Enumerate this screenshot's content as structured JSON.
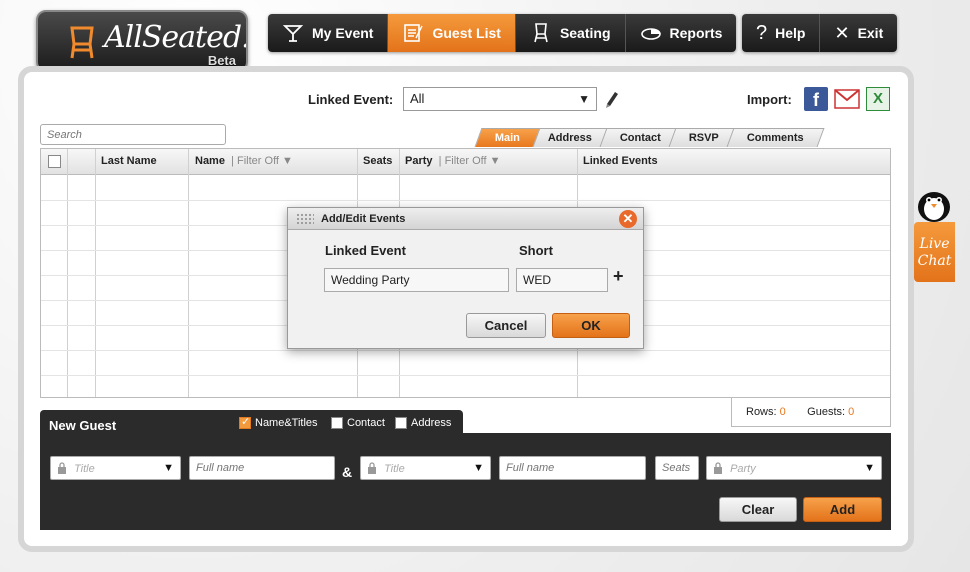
{
  "app": {
    "logo_text": "AllSeated.",
    "logo_badge": "Beta"
  },
  "nav": {
    "items": [
      {
        "label": "My Event",
        "icon": "cocktail-icon"
      },
      {
        "label": "Guest List",
        "icon": "list-icon",
        "active": true
      },
      {
        "label": "Seating",
        "icon": "chair-icon"
      },
      {
        "label": "Reports",
        "icon": "pie-chart-icon"
      }
    ],
    "help_label": "Help",
    "exit_label": "Exit"
  },
  "toolbar": {
    "linked_event_label": "Linked Event:",
    "linked_event_value": "All",
    "import_label": "Import:"
  },
  "search": {
    "placeholder": "Search"
  },
  "tabs": [
    "Main",
    "Address",
    "Contact",
    "RSVP",
    "Comments"
  ],
  "grid": {
    "headers": {
      "last_name": "Last Name",
      "name": "Name",
      "name_filter": "Filter Off",
      "seats": "Seats",
      "party": "Party",
      "party_filter": "Filter Off",
      "linked_events": "Linked Events"
    },
    "rows_label": "Rows:",
    "rows_value": "0",
    "guests_label": "Guests:",
    "guests_value": "0"
  },
  "new_guest": {
    "title": "New Guest",
    "options": [
      {
        "label": "Name&Titles",
        "checked": true
      },
      {
        "label": "Contact",
        "checked": false
      },
      {
        "label": "Address",
        "checked": false
      }
    ],
    "title1_placeholder": "Title",
    "fullname1_placeholder": "Full name",
    "amp": "&",
    "title2_placeholder": "Title",
    "fullname2_placeholder": "Full name",
    "seats_placeholder": "Seats",
    "party_placeholder": "Party",
    "clear_label": "Clear",
    "add_label": "Add"
  },
  "dialog": {
    "title": "Add/Edit Events",
    "linked_event_label": "Linked Event",
    "short_label": "Short",
    "linked_event_value": "Wedding Party",
    "short_value": "WED",
    "cancel_label": "Cancel",
    "ok_label": "OK"
  },
  "live_chat": {
    "line1": "Live",
    "line2": "Chat"
  },
  "colors": {
    "accent": "#e8781e",
    "dark": "#2b2b2b",
    "facebook": "#3b5998",
    "excel": "#2e8b3a"
  }
}
